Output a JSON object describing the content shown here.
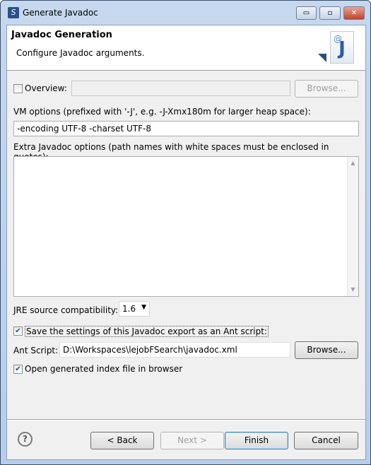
{
  "window": {
    "title": "Generate Javadoc",
    "minimize": "▭",
    "maximize": "▫",
    "close": "✕"
  },
  "header": {
    "title": "Javadoc Generation",
    "subtitle": "Configure Javadoc arguments.",
    "icon": "javadoc-wizard-icon"
  },
  "overview": {
    "label": "Overview:",
    "checked": false,
    "value": "",
    "browse": "Browse..."
  },
  "vm_options": {
    "label": "VM options (prefixed with '-J', e.g. -J-Xmx180m for larger heap space):",
    "value": "-encoding UTF-8 -charset UTF-8"
  },
  "extra_options": {
    "label": "Extra Javadoc options (path names with white spaces must be enclosed in quotes):",
    "value": ""
  },
  "jre": {
    "label": "JRE source compatibility:",
    "value": "1.6"
  },
  "save_ant": {
    "label": "Save the settings of this Javadoc export as an Ant script:",
    "checked": true
  },
  "ant_script": {
    "label": "Ant Script:",
    "value": "D:\\Workspaces\\lejobFSearch\\javadoc.xml",
    "browse": "Browse..."
  },
  "open_index": {
    "label": "Open generated index file in browser",
    "checked": true
  },
  "buttons": {
    "help": "?",
    "back": "< Back",
    "next": "Next >",
    "finish": "Finish",
    "cancel": "Cancel"
  }
}
